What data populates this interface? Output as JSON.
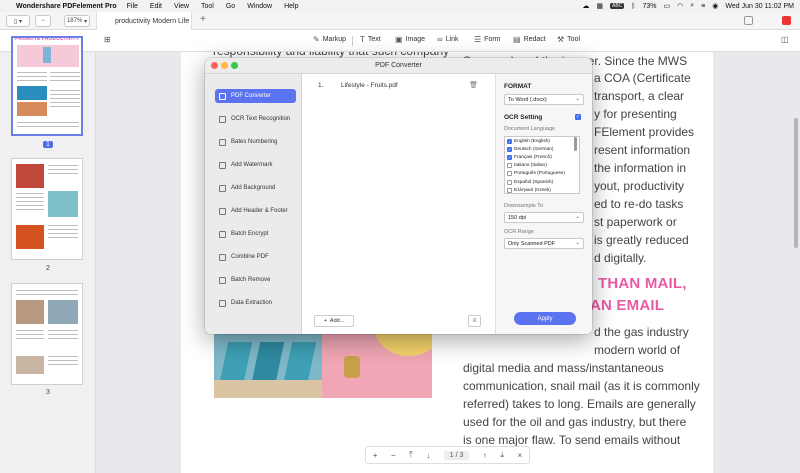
{
  "menubar": {
    "app_name": "Wondershare PDFelement Pro",
    "menus": [
      "File",
      "Edit",
      "View",
      "Tool",
      "Go",
      "Window",
      "Help"
    ],
    "keyboard": "ABC",
    "battery": "73%",
    "clock": "Wed Jun 30  11:02 PM"
  },
  "tabbar": {
    "zoom": "187%",
    "doc_tab": "productivity Modern Life",
    "add_tab": "+"
  },
  "toolbar": {
    "items": [
      {
        "label": "Markup",
        "icon": "highlighter-icon"
      },
      {
        "label": "Text",
        "icon": "text-icon"
      },
      {
        "label": "Image",
        "icon": "image-icon"
      },
      {
        "label": "Link",
        "icon": "link-icon"
      },
      {
        "label": "Form",
        "icon": "form-icon"
      },
      {
        "label": "Redact",
        "icon": "redact-icon"
      },
      {
        "label": "Tool",
        "icon": "tool-icon"
      }
    ]
  },
  "thumbnails": {
    "page1_title": "PROMOTE PRODUCTIVITY",
    "page_numbers": [
      "1",
      "2",
      "3"
    ]
  },
  "document": {
    "lines_top": [
      "responsibility and liability that such company",
      "Surveyor) and the insurer. Since the MWS",
      "a COA (Certificate",
      "transport, a clear",
      "y for presenting",
      "FElement provides",
      "resent information",
      "the information in",
      "yout, productivity",
      "ed to re-do tasks",
      "st paperwork or",
      "is greatly reduced",
      "d digitally."
    ],
    "heading_1": "THAN MAIL,",
    "heading_2": "AN EMAIL",
    "lines_bottom": [
      "d the gas industry",
      "modern world of",
      "digital  media  and  mass/instantaneous",
      "communication, snail mail (as it is commonly",
      "referred) takes to long. Emails are generally",
      "used for the oil and gas industry, but there",
      "is one major flaw. To send emails without"
    ]
  },
  "pagenav": {
    "current": "1",
    "sep": "/",
    "total": "3"
  },
  "dialog": {
    "title": "PDF Converter",
    "sidebar": [
      "PDF Converter",
      "OCR Text Recognition",
      "Bates Numbering",
      "Add Watermark",
      "Add Background",
      "Add Header & Footer",
      "Batch Encrypt",
      "Combine PDF",
      "Batch Remove",
      "Data Extraction"
    ],
    "file": {
      "index": "1.",
      "name": "Lifestyle - Fruits.pdf"
    },
    "add_label": "Add...",
    "format_label": "FORMAT",
    "format_value": "To Word (.docx)",
    "ocr_label": "OCR Setting",
    "doc_lang_label": "Document Language",
    "languages": [
      {
        "name": "English (English)",
        "checked": true
      },
      {
        "name": "Deutsch (German)",
        "checked": true
      },
      {
        "name": "Français (French)",
        "checked": true
      },
      {
        "name": "Italiano (Italian)",
        "checked": false
      },
      {
        "name": "Português (Portuguese)",
        "checked": false
      },
      {
        "name": "Español (Spanish)",
        "checked": false
      },
      {
        "name": "Ελληνικά (Greek)",
        "checked": false
      }
    ],
    "downsample_label": "Downsample To",
    "downsample_value": "150 dpi",
    "ocr_range_label": "OCR Range",
    "ocr_range_value": "Only Scanned PDF",
    "apply_label": "Apply"
  },
  "colors": {
    "accent": "#5b73f0",
    "heading_pink": "#e85ba3"
  }
}
